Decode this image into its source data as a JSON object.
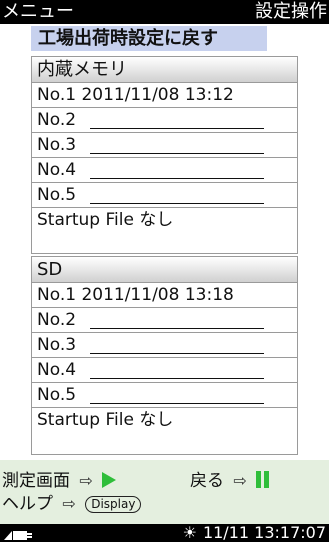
{
  "header": {
    "left": "メニュー",
    "right": "設定操作"
  },
  "reset_button": "工場出荷時設定に戻す",
  "groups": [
    {
      "title": "内蔵メモリ",
      "rows": [
        "No.1 2011/11/08 13:12",
        "No.2",
        "No.3",
        "No.4",
        "No.5",
        "Startup File なし"
      ]
    },
    {
      "title": "SD",
      "rows": [
        "No.1 2011/11/08 13:18",
        "No.2",
        "No.3",
        "No.4",
        "No.5",
        "Startup File なし"
      ]
    }
  ],
  "footer": {
    "measure_label": "測定画面",
    "back_label": "戻る",
    "help_label": "ヘルプ",
    "display_key": "Display",
    "play_color": "#2fbe3a"
  },
  "status_bar": {
    "datetime": "11/11 13:17:07",
    "icons": [
      "signal-plug-icon",
      "sun-icon"
    ]
  }
}
